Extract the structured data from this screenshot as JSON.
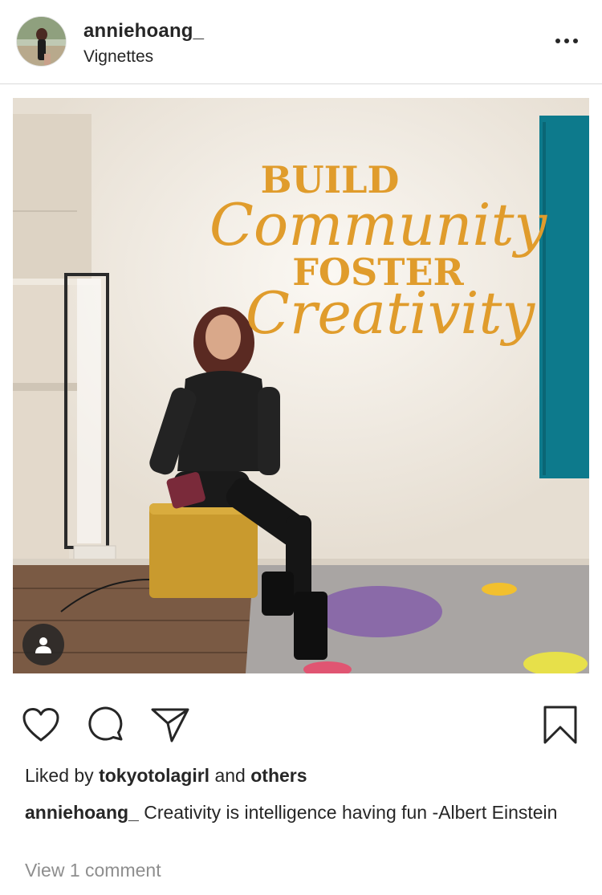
{
  "post": {
    "username": "anniehoang_",
    "location": "Vignettes"
  },
  "photo": {
    "wall_text": [
      "BUILD",
      "Community",
      "FOSTER",
      "Creativity"
    ],
    "accent_colors": {
      "lettering": "#e09c2c",
      "teal_panel": "#0d7a8c",
      "ottoman": "#c99a2e",
      "purple_dot": "#8a6aa8",
      "yellow_dot": "#f2c02e",
      "pink_dot": "#e05572"
    },
    "tag_icon": "person-icon"
  },
  "actions": {
    "like_icon": "heart-icon",
    "comment_icon": "comment-bubble-icon",
    "share_icon": "paper-plane-icon",
    "save_icon": "bookmark-icon"
  },
  "likes": {
    "prefix": "Liked by",
    "user": "tokyotolagirl",
    "middle": "and",
    "suffix": "others"
  },
  "caption": {
    "username": "anniehoang_",
    "text": "Creativity is intelligence having fun -Albert Einstein"
  },
  "comments": {
    "view_label": "View 1 comment"
  }
}
